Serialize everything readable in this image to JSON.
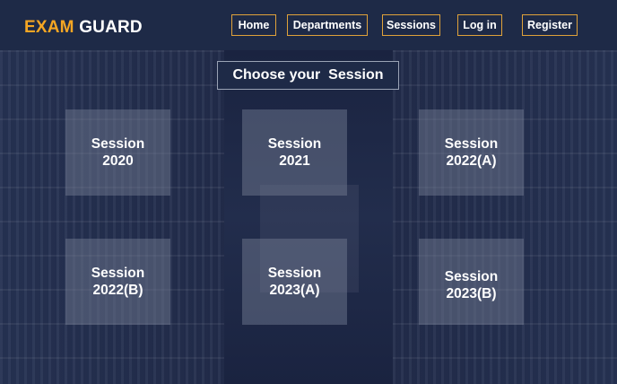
{
  "brand": {
    "part1": "EXAM",
    "part2": "GUARD",
    "color_accent": "#f5a623"
  },
  "nav": {
    "home": "Home",
    "departments": "Departments",
    "sessions": "Sessions",
    "login": "Log in",
    "register": "Register"
  },
  "page_title": "Choose your  Session",
  "sessions": [
    {
      "line1": "Session",
      "line2": "2020"
    },
    {
      "line1": "Session",
      "line2": "2021"
    },
    {
      "line1": "Session",
      "line2": "2022(A)"
    },
    {
      "line1": "Session",
      "line2": "2022(B)"
    },
    {
      "line1": "Session",
      "line2": "2023(A)"
    },
    {
      "line1": "Session",
      "line2": "2023(B)"
    }
  ]
}
